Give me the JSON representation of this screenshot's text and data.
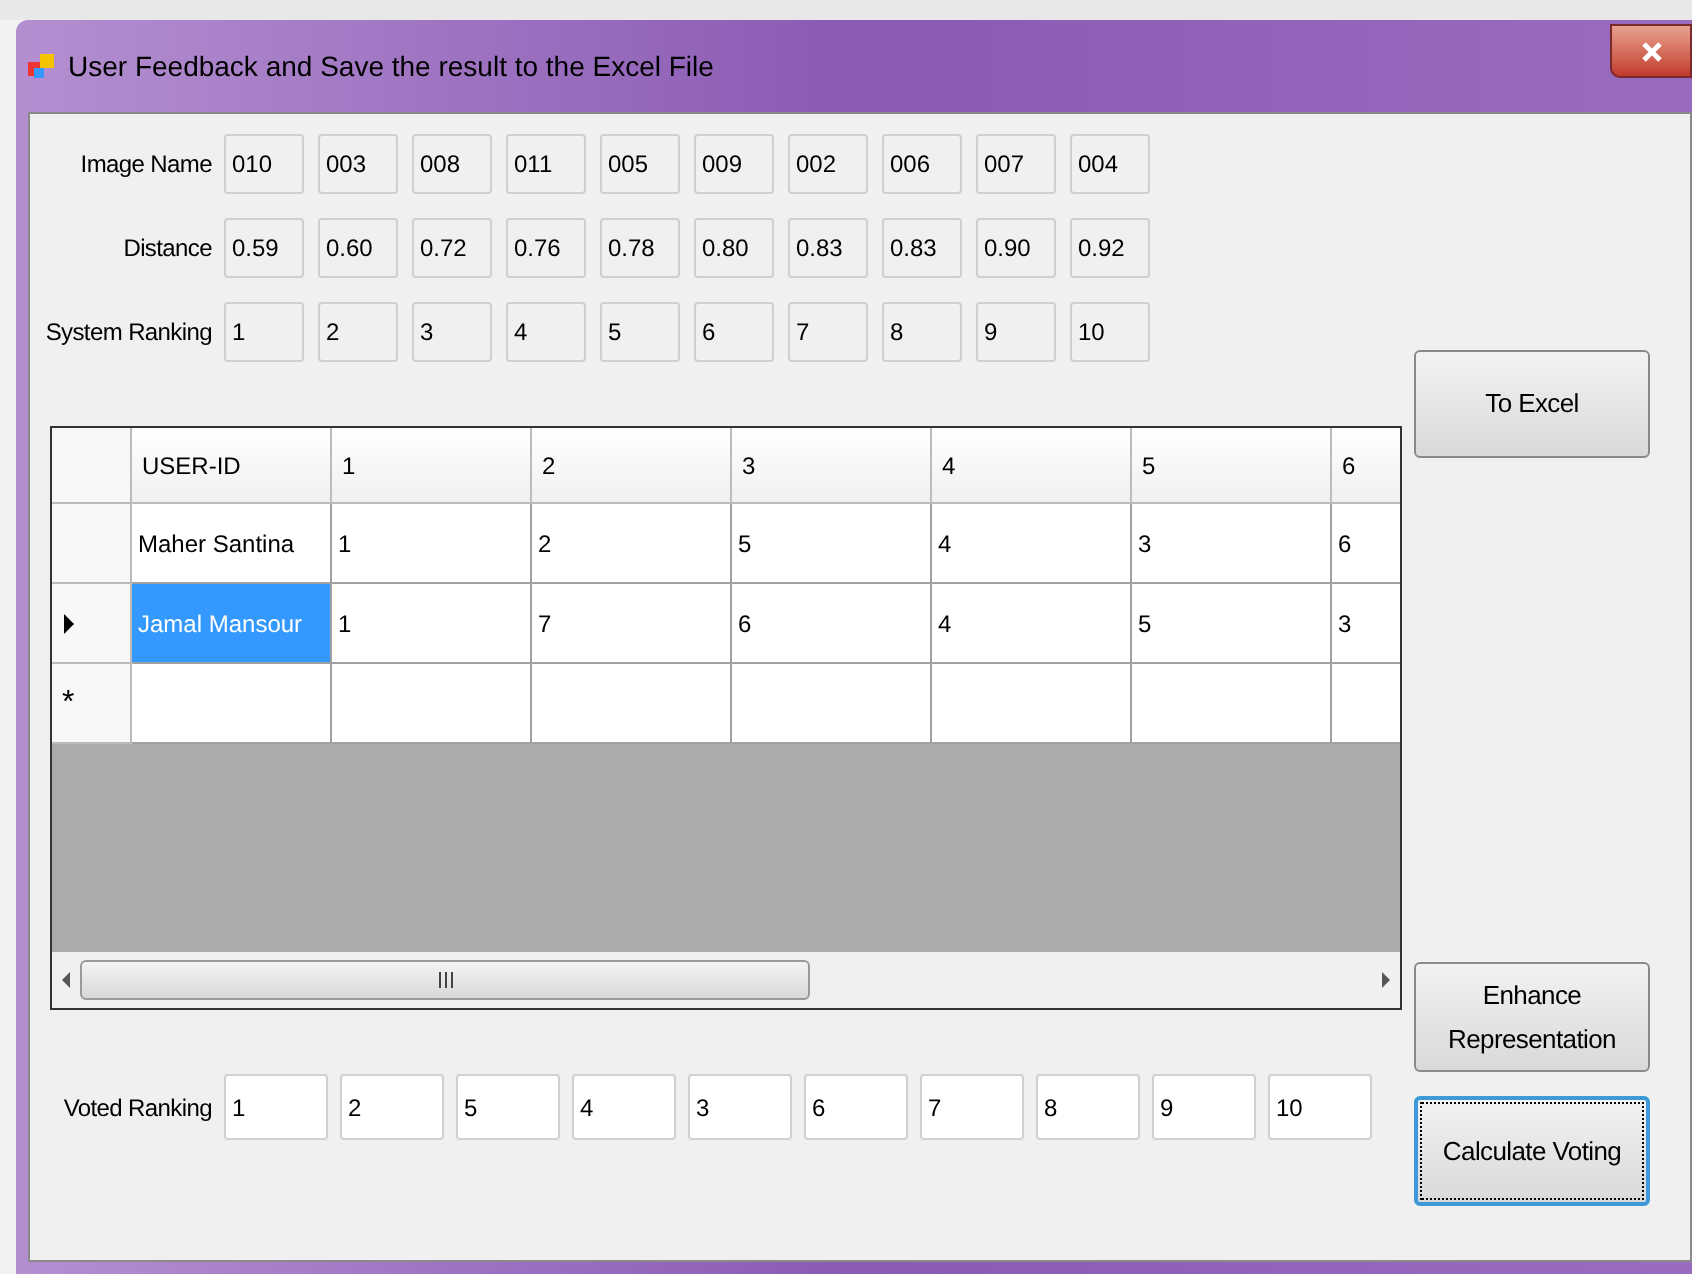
{
  "window": {
    "title": "User Feedback and Save the result to the Excel File"
  },
  "system_rows": [
    {
      "label": "Image Name",
      "values": [
        "010",
        "003",
        "008",
        "011",
        "005",
        "009",
        "002",
        "006",
        "007",
        "004"
      ]
    },
    {
      "label": "Distance",
      "values": [
        "0.59",
        "0.60",
        "0.72",
        "0.76",
        "0.78",
        "0.80",
        "0.83",
        "0.83",
        "0.90",
        "0.92"
      ]
    },
    {
      "label": "System Ranking",
      "values": [
        "1",
        "2",
        "3",
        "4",
        "5",
        "6",
        "7",
        "8",
        "9",
        "10"
      ]
    }
  ],
  "grid": {
    "columns": [
      "USER-ID",
      "1",
      "2",
      "3",
      "4",
      "5",
      "6"
    ],
    "rows": [
      {
        "cells": [
          "Maher Santina",
          "1",
          "2",
          "5",
          "4",
          "3",
          "6"
        ],
        "selected": false
      },
      {
        "cells": [
          "Jamal Mansour",
          "1",
          "7",
          "6",
          "4",
          "5",
          "3"
        ],
        "selected": true
      }
    ],
    "new_row_marker": "*"
  },
  "voted": {
    "label": "Voted Ranking",
    "values": [
      "1",
      "2",
      "5",
      "4",
      "3",
      "6",
      "7",
      "8",
      "9",
      "10"
    ]
  },
  "buttons": [
    {
      "label": "To Excel",
      "focused": false
    },
    {
      "label": "Enhance Representation",
      "focused": false
    },
    {
      "label": "Calculate Voting",
      "focused": true
    }
  ]
}
